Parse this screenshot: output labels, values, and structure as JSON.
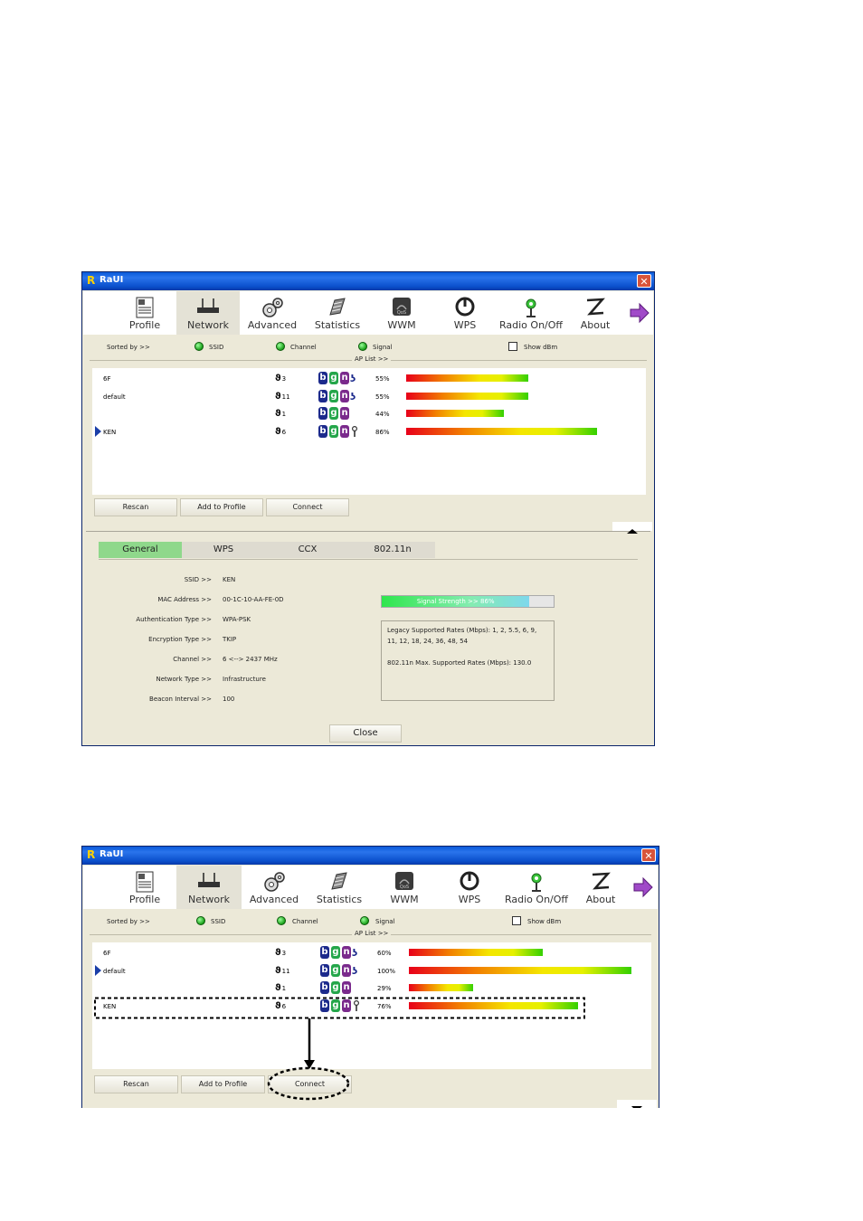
{
  "windows": [
    {
      "title": "RaUI",
      "close_label": "✕",
      "toolbar": [
        {
          "label": "Profile",
          "icon": "profile-icon"
        },
        {
          "label": "Network",
          "icon": "network-icon"
        },
        {
          "label": "Advanced",
          "icon": "advanced-icon"
        },
        {
          "label": "Statistics",
          "icon": "statistics-icon"
        },
        {
          "label": "WWM",
          "icon": "wmm-icon"
        },
        {
          "label": "WPS",
          "icon": "wps-icon"
        },
        {
          "label": "Radio On/Off",
          "icon": "radio-icon"
        },
        {
          "label": "About",
          "icon": "about-icon"
        }
      ],
      "sorted_by": "Sorted by >>",
      "sort_ssid": "SSID",
      "sort_channel": "Channel",
      "sort_signal": "Signal",
      "show_dbm": "Show dBm",
      "ap_list": "AP List >>",
      "rows": [
        {
          "ssid": "6F",
          "channel": "3",
          "pct": "55%",
          "signal": 55,
          "sec": "wpa"
        },
        {
          "ssid": "default",
          "channel": "11",
          "pct": "55%",
          "signal": 55,
          "sec": "wpa"
        },
        {
          "ssid": "",
          "channel": "1",
          "pct": "44%",
          "signal": 44,
          "sec": ""
        },
        {
          "ssid": "KEN",
          "channel": "6",
          "pct": "86%",
          "signal": 86,
          "sec": "lock",
          "selected": true
        }
      ],
      "buttons": {
        "rescan": "Rescan",
        "add": "Add to Profile",
        "connect": "Connect"
      },
      "tabs": [
        "General",
        "WPS",
        "CCX",
        "802.11n"
      ],
      "details": [
        {
          "k": "SSID >>",
          "v": "KEN"
        },
        {
          "k": "MAC Address >>",
          "v": "00-1C-10-AA-FE-0D"
        },
        {
          "k": "Authentication Type >>",
          "v": "WPA-PSK"
        },
        {
          "k": "Encryption Type >>",
          "v": "TKIP"
        },
        {
          "k": "Channel >>",
          "v": "6 <--> 2437 MHz"
        },
        {
          "k": "Network Type >>",
          "v": "Infrastructure"
        },
        {
          "k": "Beacon Interval >>",
          "v": "100"
        }
      ],
      "signal_strength": {
        "text": "Signal Strength >> 86%",
        "value": 86
      },
      "rates": {
        "legacy": "Legacy Supported Rates (Mbps): 1, 2, 5.5, 6, 9, 11, 12, 18, 24, 36, 48, 54",
        "n": "802.11n Max. Supported Rates (Mbps): 130.0"
      },
      "close_button": "Close"
    },
    {
      "title": "RaUI",
      "close_label": "✕",
      "toolbar": [
        {
          "label": "Profile",
          "icon": "profile-icon"
        },
        {
          "label": "Network",
          "icon": "network-icon"
        },
        {
          "label": "Advanced",
          "icon": "advanced-icon"
        },
        {
          "label": "Statistics",
          "icon": "statistics-icon"
        },
        {
          "label": "WWM",
          "icon": "wmm-icon"
        },
        {
          "label": "WPS",
          "icon": "wps-icon"
        },
        {
          "label": "Radio On/Off",
          "icon": "radio-icon"
        },
        {
          "label": "About",
          "icon": "about-icon"
        }
      ],
      "sorted_by": "Sorted by >>",
      "sort_ssid": "SSID",
      "sort_channel": "Channel",
      "sort_signal": "Signal",
      "show_dbm": "Show dBm",
      "ap_list": "AP List >>",
      "rows": [
        {
          "ssid": "6F",
          "channel": "3",
          "pct": "60%",
          "signal": 60,
          "sec": "wpa"
        },
        {
          "ssid": "default",
          "channel": "11",
          "pct": "100%",
          "signal": 100,
          "sec": "wpa",
          "selected": true
        },
        {
          "ssid": "",
          "channel": "1",
          "pct": "29%",
          "signal": 29,
          "sec": ""
        },
        {
          "ssid": "KEN",
          "channel": "6",
          "pct": "76%",
          "signal": 76,
          "sec": "lock"
        }
      ],
      "buttons": {
        "rescan": "Rescan",
        "add": "Add to Profile",
        "connect": "Connect"
      }
    }
  ],
  "colors": {
    "title_blue": "#0a4fcb",
    "tab_active": "#8fd88b",
    "badge_b": "#1c2a8c",
    "badge_g": "#24a64a",
    "badge_n": "#7a2a8c"
  }
}
